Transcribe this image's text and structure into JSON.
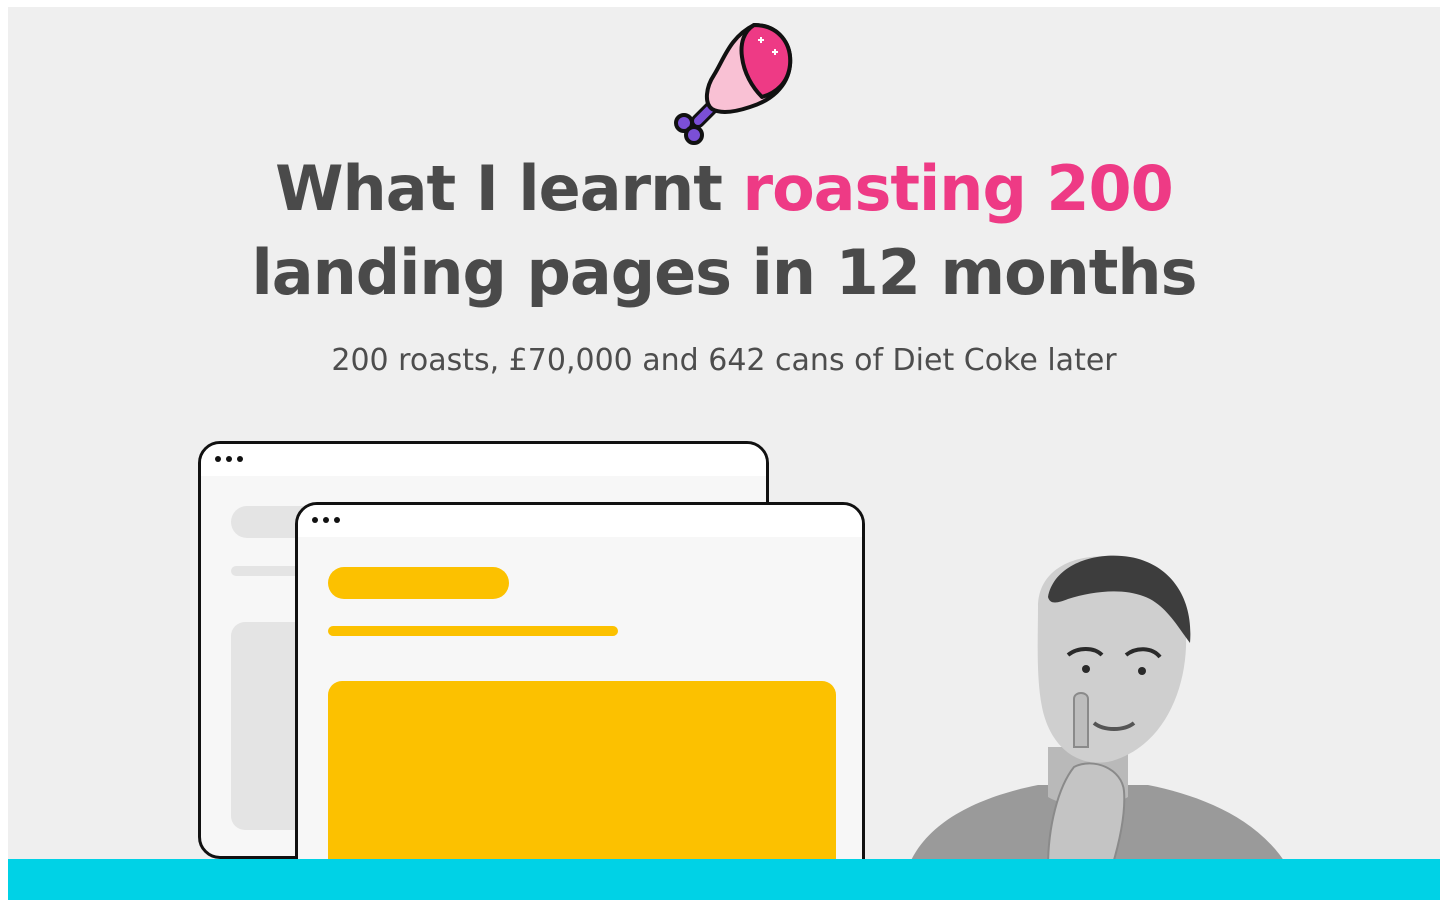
{
  "headline": {
    "part1": "What I learnt ",
    "accent": "roasting 200",
    "part2": "landing pages in 12 months"
  },
  "subtitle": "200 roasts, £70,000 and 642 cans of Diet Coke later",
  "colors": {
    "background": "#efefef",
    "headline": "#4a4a4a",
    "accent": "#ee3a85",
    "highlight": "#fcc100",
    "bottom_bar": "#00d2e6"
  },
  "icons": {
    "top": "chicken-drumstick-icon"
  },
  "illustration": {
    "windows": [
      "browser-window-back",
      "browser-window-front"
    ],
    "person": "thinking-man-photo"
  }
}
